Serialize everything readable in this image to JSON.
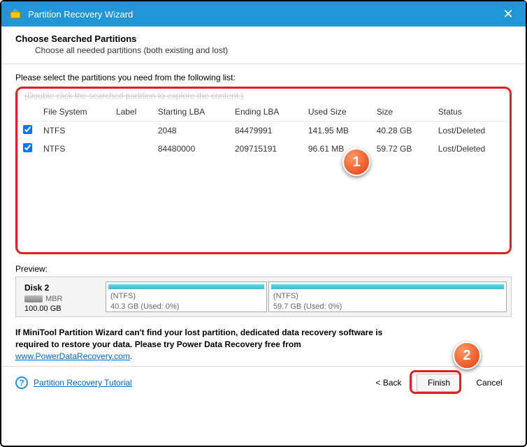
{
  "titlebar": {
    "title": "Partition Recovery Wizard"
  },
  "header": {
    "heading": "Choose Searched Partitions",
    "sub": "Choose all needed partitions (both existing and lost)"
  },
  "instruct": "Please select the partitions you need from the following list:",
  "hint": "(Double click the searched partition to explore the content.)",
  "columns": {
    "fs": "File System",
    "label": "Label",
    "start": "Starting LBA",
    "end": "Ending LBA",
    "used": "Used Size",
    "size": "Size",
    "status": "Status"
  },
  "rows": [
    {
      "fs": "NTFS",
      "label": "",
      "start": "2048",
      "end": "84479991",
      "used": "141.95 MB",
      "size": "40.28 GB",
      "status": "Lost/Deleted"
    },
    {
      "fs": "NTFS",
      "label": "",
      "start": "84480000",
      "end": "209715191",
      "used": "96.61 MB",
      "size": "59.72 GB",
      "status": "Lost/Deleted"
    }
  ],
  "preview": {
    "label": "Preview:",
    "disk": {
      "name": "Disk 2",
      "type": "MBR",
      "size": "100.00 GB"
    },
    "parts": [
      {
        "fs": "(NTFS)",
        "detail": "40.3 GB (Used: 0%)"
      },
      {
        "fs": "(NTFS)",
        "detail": "59.7 GB (Used: 0%)"
      }
    ]
  },
  "note": {
    "bold1": "If MiniTool Partition Wizard can't find your lost partition, dedicated data recovery software is",
    "bold2": "required to restore your data. Please try Power Data Recovery free from",
    "link": "www.PowerDataRecovery.com"
  },
  "footer": {
    "tutorial": "Partition Recovery Tutorial",
    "back": "< Back",
    "finish": "Finish",
    "cancel": "Cancel"
  },
  "callouts": {
    "one": "1",
    "two": "2"
  }
}
